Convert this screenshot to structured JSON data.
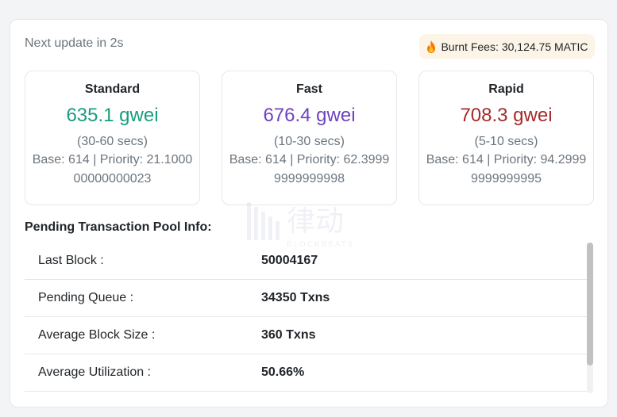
{
  "header": {
    "update_text": "Next update in 2s",
    "burnt_fees_label": "Burnt Fees:",
    "burnt_fees_value": "30,124.75 MATIC",
    "fire_icon": "fire-icon"
  },
  "gas_tiers": [
    {
      "title": "Standard",
      "price": "635.1 gwei",
      "time": "(30-60 secs)",
      "detail": "Base: 614 | Priority: 21.100000000000023",
      "color": "#199c7f"
    },
    {
      "title": "Fast",
      "price": "676.4 gwei",
      "time": "(10-30 secs)",
      "detail": "Base: 614 | Priority: 62.39999999999998",
      "color": "#6f42c1"
    },
    {
      "title": "Rapid",
      "price": "708.3 gwei",
      "time": "(5-10 secs)",
      "detail": "Base: 614 | Priority: 94.29999999999995",
      "color": "#a52a2a"
    }
  ],
  "pool": {
    "heading": "Pending Transaction Pool Info:",
    "rows": [
      {
        "label": "Last Block :",
        "value": "50004167"
      },
      {
        "label": "Pending Queue :",
        "value": "34350 Txns"
      },
      {
        "label": "Average Block Size :",
        "value": "360 Txns"
      },
      {
        "label": "Average Utilization :",
        "value": "50.66%"
      }
    ]
  },
  "watermark": {
    "text": "律动",
    "subtext": "BLOCKBEATS"
  }
}
